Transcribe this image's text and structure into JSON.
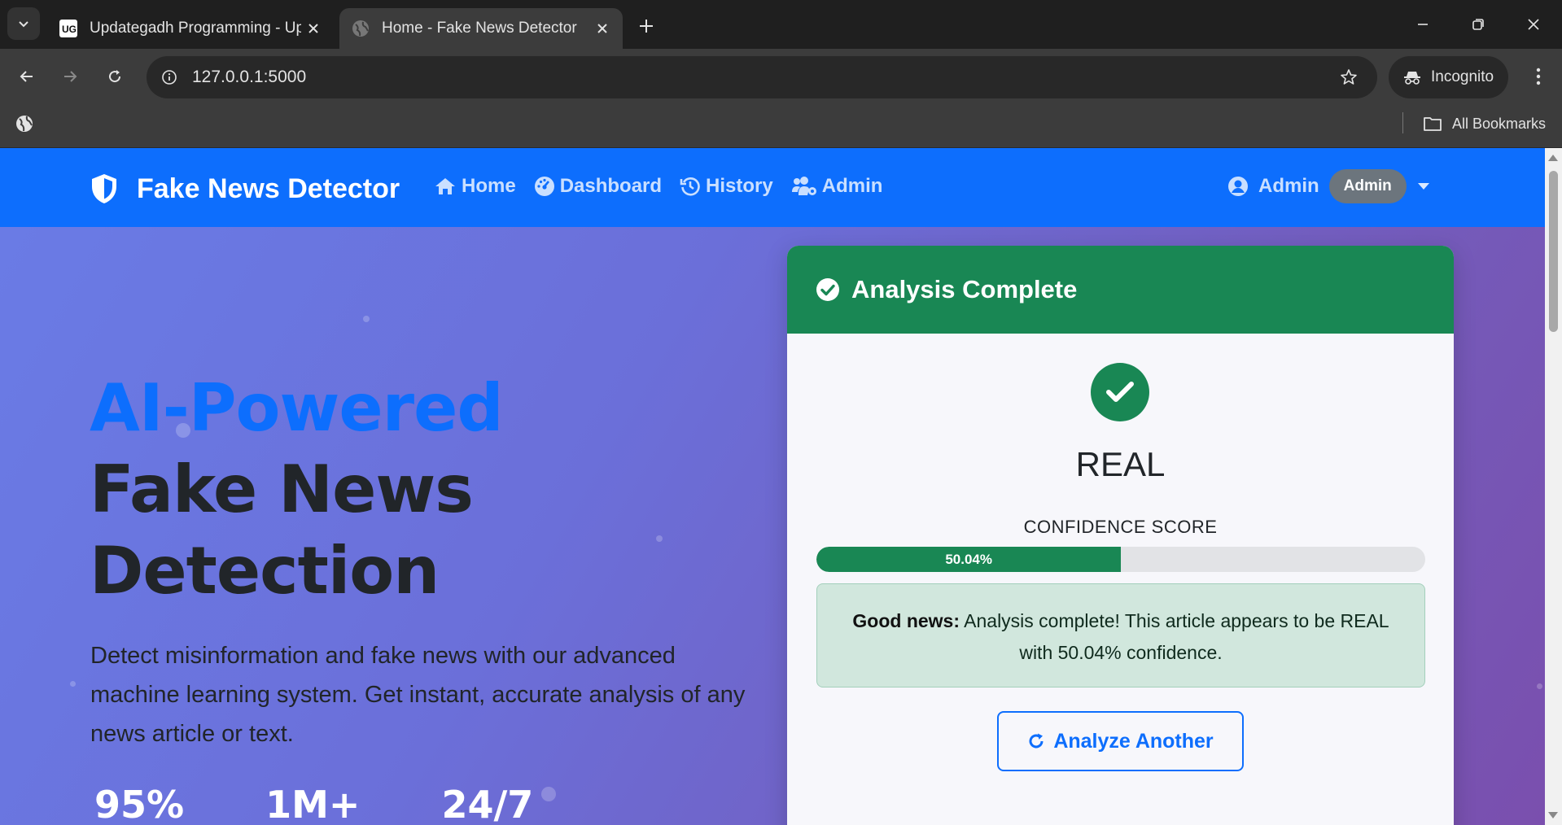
{
  "browser": {
    "tabs": [
      {
        "title": "Updategadh Programming - Up",
        "favicon": "ug-logo-icon"
      },
      {
        "title": "Home - Fake News Detector",
        "favicon": "globe-icon"
      }
    ],
    "url": "127.0.0.1:5000",
    "incognito_label": "Incognito",
    "bookmarks_label": "All Bookmarks"
  },
  "app": {
    "brand": "Fake News Detector",
    "nav": [
      {
        "label": "Home",
        "icon": "home-icon"
      },
      {
        "label": "Dashboard",
        "icon": "dashboard-icon"
      },
      {
        "label": "History",
        "icon": "history-icon"
      },
      {
        "label": "Admin",
        "icon": "users-cog-icon"
      }
    ],
    "user": {
      "name": "Admin",
      "role": "Admin"
    },
    "colors": {
      "primary": "#0d6efd",
      "success": "#198754",
      "secondary": "#6c757d"
    }
  },
  "hero": {
    "title_highlight": "AI-Powered",
    "title_line2": "Fake News",
    "title_line3": "Detection",
    "description": "Detect misinformation and fake news with our advanced machine learning system. Get instant, accurate analysis of any news article or text.",
    "stats": [
      "95%",
      "1M+",
      "24/7"
    ]
  },
  "result": {
    "header": "Analysis Complete",
    "verdict": "REAL",
    "confidence_label": "CONFIDENCE SCORE",
    "confidence_percent": 50.04,
    "confidence_text": "50.04%",
    "alert_strong": "Good news:",
    "alert_text": "Analysis complete! This article appears to be REAL with 50.04% confidence.",
    "button_label": "Analyze Another"
  }
}
